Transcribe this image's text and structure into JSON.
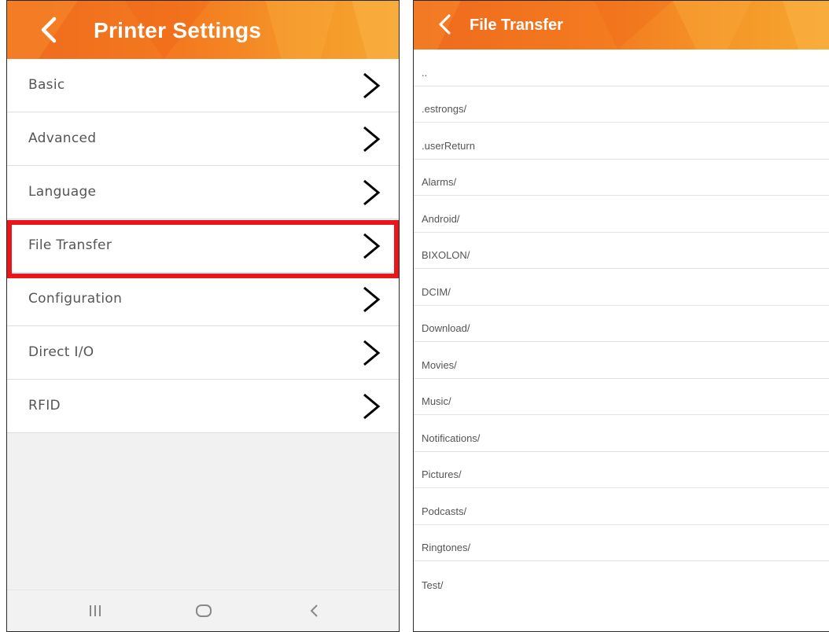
{
  "left_screen": {
    "header": {
      "title": "Printer Settings"
    },
    "menu": [
      {
        "label": "Basic"
      },
      {
        "label": "Advanced"
      },
      {
        "label": "Language"
      },
      {
        "label": "File Transfer",
        "highlighted": true
      },
      {
        "label": "Configuration"
      },
      {
        "label": "Direct I/O"
      },
      {
        "label": "RFID"
      }
    ],
    "navbar": [
      "recent-apps-icon",
      "home-icon",
      "back-icon"
    ]
  },
  "right_screen": {
    "header": {
      "title": "File Transfer"
    },
    "files": [
      {
        "name": ".."
      },
      {
        "name": ".estrongs/"
      },
      {
        "name": ".userReturn"
      },
      {
        "name": "Alarms/"
      },
      {
        "name": "Android/"
      },
      {
        "name": "BIXOLON/"
      },
      {
        "name": "DCIM/"
      },
      {
        "name": "Download/"
      },
      {
        "name": "Movies/"
      },
      {
        "name": "Music/"
      },
      {
        "name": "Notifications/"
      },
      {
        "name": "Pictures/"
      },
      {
        "name": "Podcasts/"
      },
      {
        "name": "Ringtones/"
      },
      {
        "name": "Test/"
      }
    ]
  },
  "colors": {
    "header_orange": "#f47a1f",
    "highlight_red": "#e8161b",
    "text_gray": "#555555"
  }
}
